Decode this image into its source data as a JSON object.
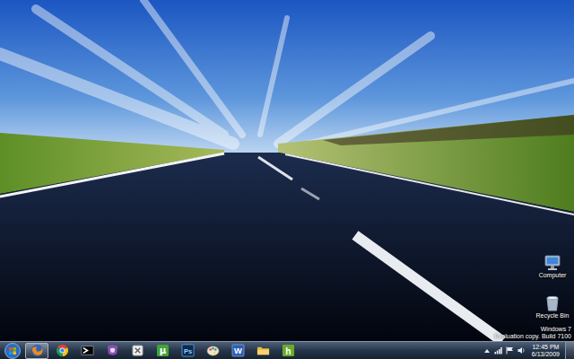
{
  "desktop": {
    "icons": [
      {
        "label": "Computer",
        "kind": "computer"
      },
      {
        "label": "Recycle Bin",
        "kind": "recycle-bin"
      }
    ],
    "watermark": [
      "Windows 7",
      "Evaluation copy. Build 7100"
    ]
  },
  "taskbar": {
    "items": [
      {
        "kind": "firefox",
        "selected": true
      },
      {
        "kind": "chrome",
        "selected": false
      },
      {
        "kind": "terminal",
        "selected": false
      },
      {
        "kind": "messenger",
        "selected": false
      },
      {
        "kind": "gadget",
        "selected": false
      },
      {
        "kind": "torrent",
        "glyph": "µ",
        "selected": false
      },
      {
        "kind": "photoshop",
        "glyph": "Ps",
        "selected": false
      },
      {
        "kind": "paint",
        "selected": false
      },
      {
        "kind": "word",
        "glyph": "W",
        "selected": false
      },
      {
        "kind": "folder",
        "selected": false
      },
      {
        "kind": "editor",
        "glyph": "h",
        "selected": false
      }
    ],
    "tray": [
      {
        "kind": "show-hidden"
      },
      {
        "kind": "network"
      },
      {
        "kind": "flag"
      },
      {
        "kind": "volume"
      }
    ],
    "clock": {
      "time": "12:45 PM",
      "date": "6/13/2009"
    }
  }
}
